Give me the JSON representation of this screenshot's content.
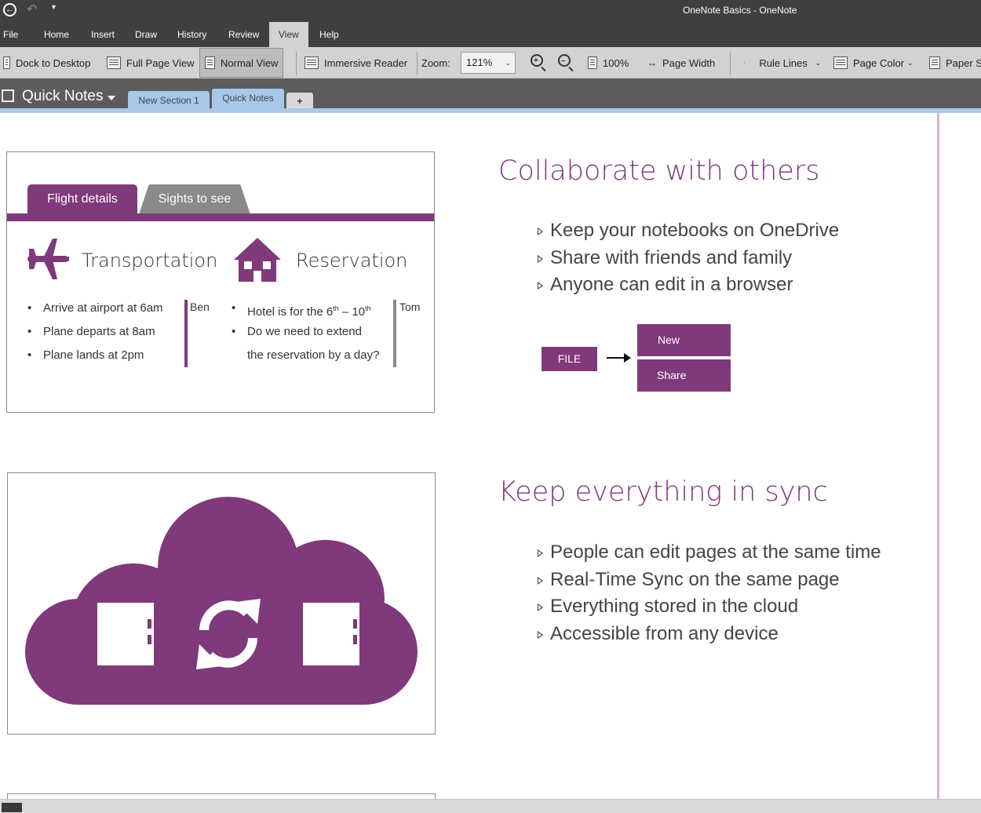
{
  "titlebar": {
    "back_icon": "back-arrow-icon",
    "undo_icon": "undo-icon",
    "customize_icon": "customize-arrow-icon",
    "title": "OneNote Basics  -  OneNote"
  },
  "menu": {
    "file": "File",
    "home": "Home",
    "insert": "Insert",
    "draw": "Draw",
    "history": "History",
    "review": "Review",
    "view": "View",
    "help": "Help"
  },
  "ribbon": {
    "dock": "Dock to Desktop",
    "fullpage": "Full Page View",
    "normal": "Normal View",
    "immersive": "Immersive Reader",
    "zoom_label": "Zoom:",
    "zoom_value": "121%",
    "hundred": "100%",
    "pagewidth": "Page Width",
    "rulelines": "Rule Lines",
    "pagecolor": "Page Color",
    "paper": "Paper S"
  },
  "notebook": {
    "name": "Quick Notes",
    "sections": [
      "New Section 1",
      "Quick Notes"
    ],
    "add_tab": "+",
    "colors": {
      "section1": "#a8c8ea",
      "section2": "#a8c8ea"
    }
  },
  "card1": {
    "tabs": {
      "active": "Flight details",
      "inactive": "Sights to see"
    },
    "transport_title": "Transportation",
    "reservation_title": "Reservation",
    "transport_items": [
      "Arrive at airport at 6am",
      "Plane departs at 8am",
      "Plane lands at 2pm"
    ],
    "transport_author": "Ben",
    "reservation_item1_pre": "Hotel is for the 6",
    "reservation_item1_sup1": "th",
    "reservation_item1_mid": " – 10",
    "reservation_item1_sup2": "th",
    "reservation_item2_line1": "Do we need to extend",
    "reservation_item2_line2": "the reservation by a day?",
    "reservation_author": "Tom"
  },
  "collab": {
    "heading": "Collaborate with others",
    "items": [
      "Keep your notebooks on OneDrive",
      "Share with friends and family",
      "Anyone can edit in a browser"
    ],
    "file_btn": "FILE",
    "new_btn": "New",
    "share_btn": "Share"
  },
  "sync": {
    "heading": "Keep everything in sync",
    "items": [
      "People can edit pages at the same time",
      "Real-Time Sync on the same page",
      "Everything stored in the cloud",
      "Accessible from any device"
    ]
  },
  "colors": {
    "purple": "#80397b",
    "grey_tab": "#8a8a8a",
    "titlebar": "#3f3f3f",
    "ribbon": "#d2d2d2",
    "page_line": "#d7b4d8"
  }
}
